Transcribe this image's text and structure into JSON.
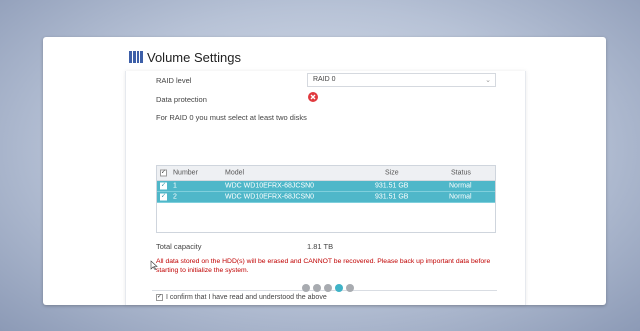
{
  "title": "Volume Settings",
  "raid": {
    "label": "RAID level",
    "selected": "RAID 0"
  },
  "protection": {
    "label": "Data protection",
    "status": "disabled"
  },
  "hint": "For RAID 0 you must select at least two disks",
  "table": {
    "headers": [
      "Number",
      "Model",
      "Size",
      "Status"
    ],
    "rows": [
      {
        "number": "1",
        "model": "WDC WD10EFRX-68JCSN0",
        "size": "931.51 GB",
        "status": "Normal"
      },
      {
        "number": "2",
        "model": "WDC WD10EFRX-68JCSN0",
        "size": "931.51 GB",
        "status": "Normal"
      }
    ]
  },
  "capacity": {
    "label": "Total capacity",
    "value": "1.81 TB"
  },
  "warning": "All data stored on the HDD(s) will be erased and CANNOT be recovered. Please back up important data before starting to initialize the system.",
  "confirm": "I confirm that I have read and understood the above",
  "pager": {
    "count": 5,
    "active_index": 3
  },
  "colors": {
    "accent": "#4fb7c9",
    "warning": "#c00000",
    "title_icon": "#3d5fa8"
  }
}
